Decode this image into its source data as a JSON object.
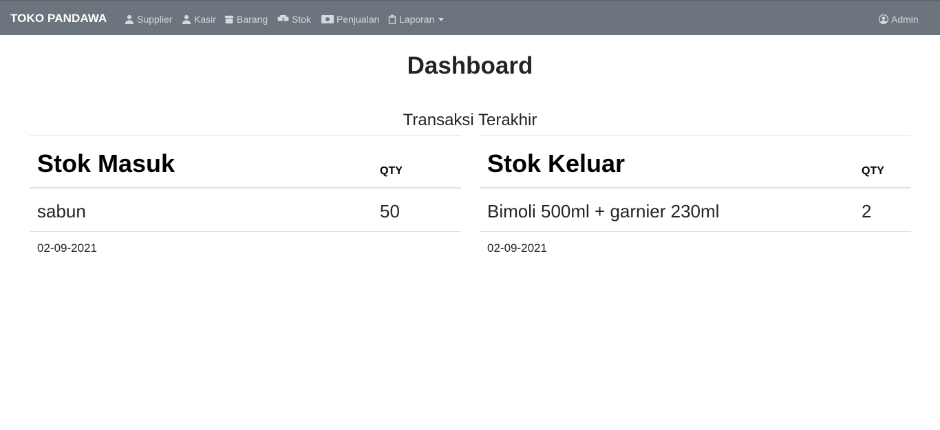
{
  "navbar": {
    "brand": "TOKO PANDAWA",
    "items": [
      {
        "label": "Supplier",
        "icon": "user-icon"
      },
      {
        "label": "Kasir",
        "icon": "user-icon"
      },
      {
        "label": "Barang",
        "icon": "box-icon"
      },
      {
        "label": "Stok",
        "icon": "boxes-icon"
      },
      {
        "label": "Penjualan",
        "icon": "money-icon"
      },
      {
        "label": "Laporan",
        "icon": "clipboard-icon"
      }
    ],
    "account": {
      "label": "Admin",
      "icon": "user-circle-icon"
    }
  },
  "page": {
    "title": "Dashboard",
    "subtitle": "Transaksi Terakhir"
  },
  "stok_masuk": {
    "heading": "Stok Masuk",
    "qty_header": "QTY",
    "rows": [
      {
        "item": "sabun",
        "qty": "50",
        "date": "02-09-2021"
      }
    ]
  },
  "stok_keluar": {
    "heading": "Stok Keluar",
    "qty_header": "QTY",
    "rows": [
      {
        "item": "Bimoli 500ml + garnier 230ml",
        "qty": "2",
        "date": "02-09-2021"
      }
    ]
  },
  "colors": {
    "navbar_bg": "#6c757d",
    "nav_text": "#d6d9dc",
    "brand_text": "#ffffff"
  }
}
